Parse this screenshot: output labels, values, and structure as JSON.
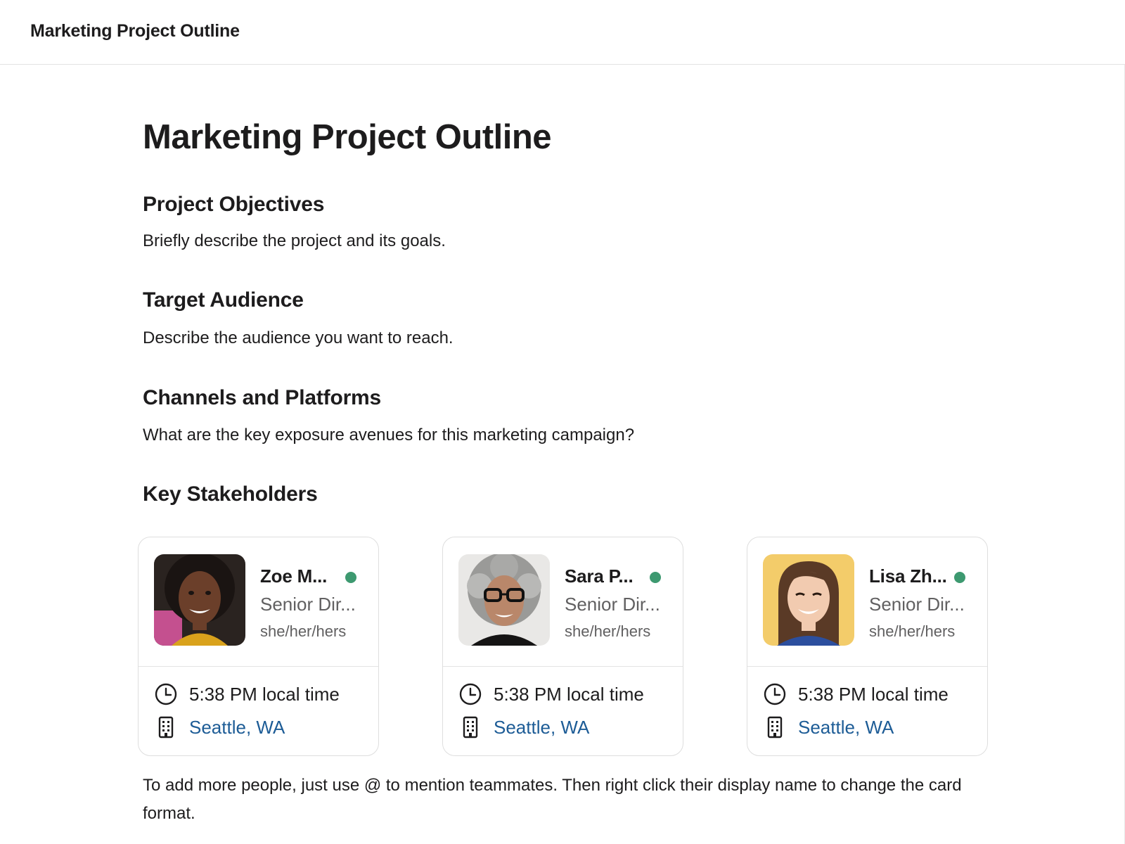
{
  "header": {
    "title": "Marketing Project Outline"
  },
  "document": {
    "title": "Marketing Project Outline",
    "sections": [
      {
        "heading": "Project Objectives",
        "body": "Briefly describe the project and its goals."
      },
      {
        "heading": "Target Audience",
        "body": "Describe the audience you want to reach."
      },
      {
        "heading": "Channels and Platforms",
        "body": "What are the key exposure avenues for this marketing campaign?"
      },
      {
        "heading": "Key Stakeholders",
        "body": ""
      }
    ],
    "stakeholders": [
      {
        "name": "Zoe M...",
        "title": "Senior Dir...",
        "pronouns": "she/her/hers",
        "local_time": "5:38 PM local time",
        "location": "Seattle, WA",
        "status": "online",
        "avatar": "person-avatar-icon"
      },
      {
        "name": "Sara P...",
        "title": "Senior Dir...",
        "pronouns": "she/her/hers",
        "local_time": "5:38 PM local time",
        "location": "Seattle, WA",
        "status": "online",
        "avatar": "person-avatar-icon"
      },
      {
        "name": "Lisa Zh...",
        "title": "Senior Dir...",
        "pronouns": "she/her/hers",
        "local_time": "5:38 PM local time",
        "location": "Seattle, WA",
        "status": "online",
        "avatar": "person-avatar-icon"
      }
    ],
    "footer": "To add more people, just use @ to mention teammates. Then right click their display name to change the card format."
  },
  "colors": {
    "status_online": "#3d9970",
    "link": "#1d5c96",
    "text": "#1d1c1d",
    "muted": "#616061"
  },
  "icons": {
    "time": "clock-icon",
    "location": "building-icon"
  }
}
